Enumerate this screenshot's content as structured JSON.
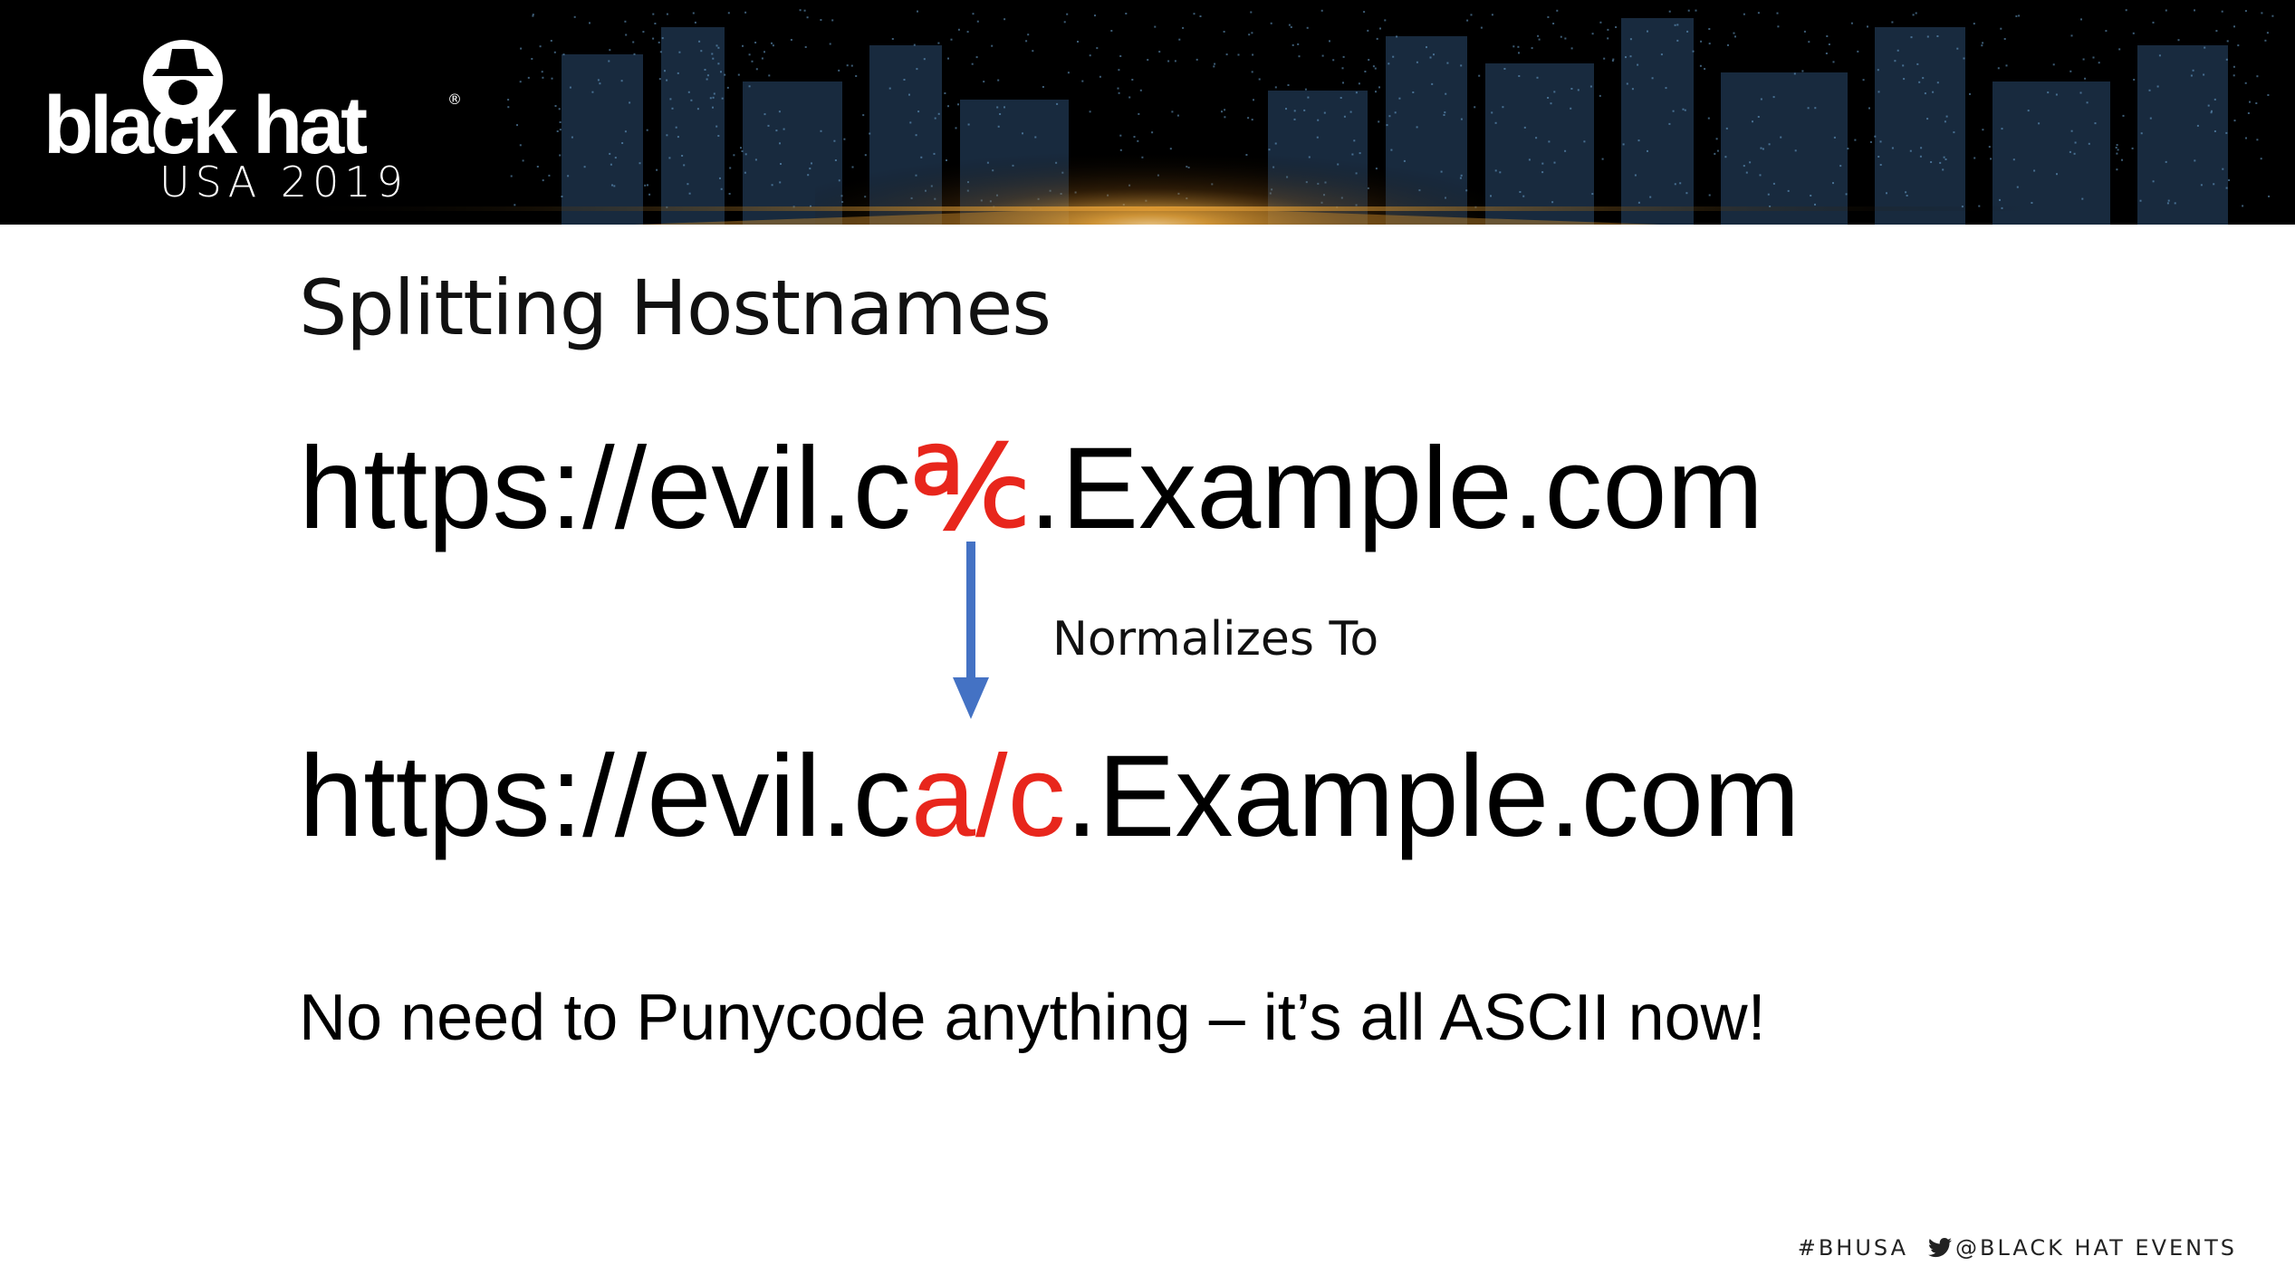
{
  "banner": {
    "brand": "black hat",
    "edition": "USA 2019",
    "registered": "®"
  },
  "slide": {
    "title": "Splitting Hostnames",
    "url_before": {
      "prefix": "https://evil.c",
      "special": "℀",
      "suffix": ".Example.com"
    },
    "arrow_label": "Normalizes To",
    "url_after": {
      "prefix": "https://evil.c",
      "highlight": "a/c",
      "suffix": ".Example.com"
    },
    "note": "No need to Punycode anything – it’s all ASCII now!"
  },
  "footer": {
    "hashtag": "#BHUSA",
    "twitter_handle": "@BLACK HAT EVENTS"
  },
  "colors": {
    "highlight": "#e8261c",
    "arrow": "#4472c4",
    "banner_bg": "#000000"
  }
}
